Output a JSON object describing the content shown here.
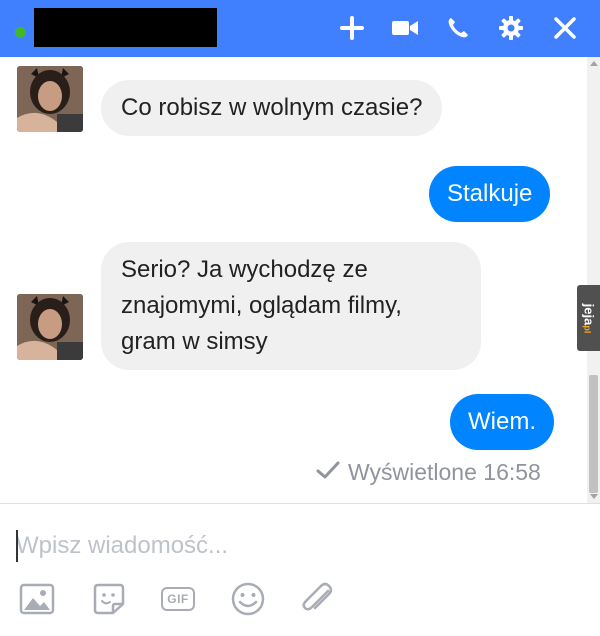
{
  "header": {
    "background": "#4080ff",
    "status_color": "#42b72a",
    "icons": [
      "plus-icon",
      "video-camera-icon",
      "phone-icon",
      "gear-icon",
      "close-icon"
    ]
  },
  "messages": [
    {
      "direction": "incoming",
      "text": "Co robisz w wolnym czasie?"
    },
    {
      "direction": "outgoing",
      "text": "Stalkuje"
    },
    {
      "direction": "incoming",
      "text": "Serio? Ja wychodzę ze\nznajomymi, oglądam filmy,\ngram w simsy"
    },
    {
      "direction": "outgoing",
      "text": "Wiem."
    }
  ],
  "seen_status": {
    "icon": "checkmark-icon",
    "text": "Wyświetlone 16:58"
  },
  "composer": {
    "placeholder": "Wpisz wiadomość...",
    "value": ""
  },
  "toolbar": {
    "icons": [
      "image-icon",
      "sticker-icon",
      "gif-icon",
      "emoji-icon",
      "attachment-icon"
    ],
    "gif_label": "GIF"
  },
  "watermark": {
    "text": "jeja",
    "suffix": "pl"
  },
  "colors": {
    "accent": "#4080ff",
    "outgoing_bubble": "#0084ff",
    "incoming_bubble": "#f1f0f0",
    "muted_text": "#90949c"
  }
}
